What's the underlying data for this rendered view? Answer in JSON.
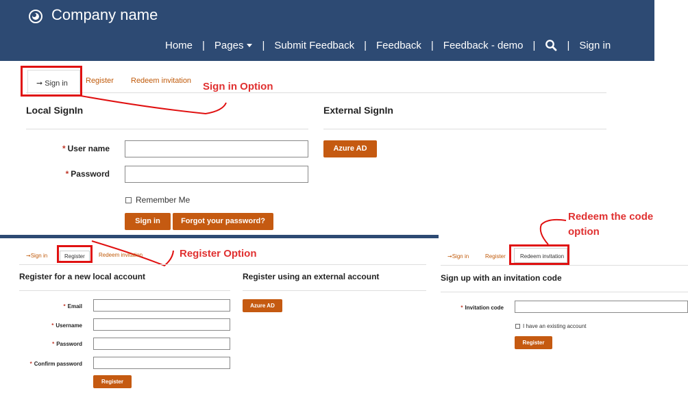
{
  "brand": "Company name",
  "nav": {
    "items": [
      "Home",
      "Pages",
      "Submit Feedback",
      "Feedback",
      "Feedback - demo",
      "Sign in"
    ]
  },
  "signin_panel": {
    "tabs": [
      "Sign in",
      "Register",
      "Redeem invitation"
    ],
    "local_heading": "Local SignIn",
    "external_heading": "External SignIn",
    "username_label": "User name",
    "password_label": "Password",
    "remember_label": "Remember Me",
    "signin_button": "Sign in",
    "forgot_button": "Forgot your password?",
    "azure_button": "Azure AD"
  },
  "register_panel": {
    "tabs": [
      "Sign in",
      "Register",
      "Redeem invitation"
    ],
    "local_heading": "Register for a new local account",
    "external_heading": "Register using an external account",
    "email_label": "Email",
    "username_label": "Username",
    "password_label": "Password",
    "confirm_label": "Confirm password",
    "register_button": "Register",
    "azure_button": "Azure AD"
  },
  "redeem_panel": {
    "tabs": [
      "Sign in",
      "Register",
      "Redeem invitation"
    ],
    "heading": "Sign up with an invitation code",
    "code_label": "Invitation code",
    "existing_label": "I have an existing account",
    "register_button": "Register"
  },
  "callouts": {
    "signin": "Sign in Option",
    "register": "Register Option",
    "redeem_line1": "Redeem the code",
    "redeem_line2": "option"
  },
  "required_mark": "*",
  "colors": {
    "banner": "#2d4a73",
    "button": "#c55a11",
    "link": "#c05a0a",
    "callout": "#e03030"
  }
}
